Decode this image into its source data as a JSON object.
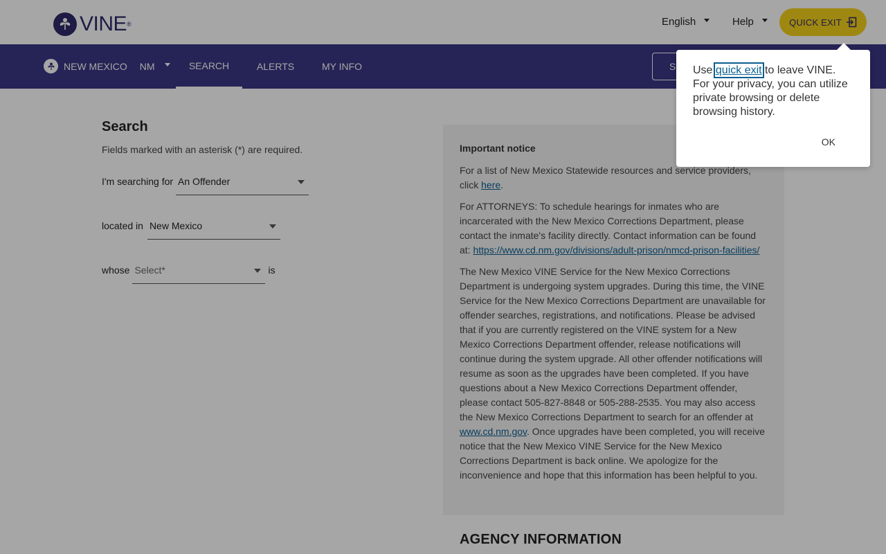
{
  "header": {
    "logo_text": "VINE",
    "logo_reg": "®",
    "language": "English",
    "help": "Help",
    "quick_exit": "QUICK EXIT"
  },
  "nav": {
    "state_name": "NEW MEXICO",
    "state_code": "NM",
    "tabs": [
      {
        "label": "SEARCH",
        "active": true
      },
      {
        "label": "ALERTS",
        "active": false
      },
      {
        "label": "MY INFO",
        "active": false
      }
    ],
    "right_button": "S"
  },
  "search": {
    "title": "Search",
    "hint": "Fields marked with an asterisk (*) are required.",
    "searching_for_label": "I'm searching for",
    "searching_for_value": "An Offender",
    "located_in_label": "located in",
    "located_in_value": "New Mexico",
    "whose_label": "whose",
    "whose_placeholder": "Select*",
    "is_label": "is"
  },
  "notice": {
    "title": "Important notice",
    "p1_text": "For a list of New Mexico Statewide resources and service providers, click ",
    "p1_link": "here",
    "p1_end": ".",
    "p2_text": "For ATTORNEYS: To schedule hearings for inmates who are incarcerated with the New Mexico Corrections Department, please contact the inmate's facility directly. Contact information can be found at: ",
    "p2_link": "https://www.cd.nm.gov/divisions/adult-prison/nmcd-prison-facilities/",
    "p3_text": "The New Mexico VINE Service for the New Mexico Corrections Department is undergoing system upgrades. During this time, the VINE Service for the New Mexico Corrections Department are unavailable for offender searches, registrations, and notifications. Please be advised that if you are currently registered on the VINE system for a New Mexico Corrections Department offender, release notifications will continue during the system upgrade. All other offender notifications will resume as soon as the upgrades have been completed. If you have questions about a New Mexico Corrections Department offender, please contact 505-827-8848 or 505-288-2535. You may also access the New Mexico Corrections Department to search for an offender at ",
    "p3_link": "www.cd.nm.gov",
    "p3_end": ". Once upgrades have been completed, you will receive notice that the New Mexico VINE Service for the New Mexico Corrections Department is back online. We apologize for the inconvenience and hope that this information has been helpful to you."
  },
  "agency_title": "AGENCY INFORMATION",
  "popover": {
    "text_before": "Use ",
    "link": "quick exit",
    "text_after": " to leave VINE. For your privacy, you can utilize private browsing or delete browsing history.",
    "ok": "OK"
  },
  "colors": {
    "brand": "#3b3784",
    "quick_exit": "#f3d21b",
    "link": "#0b5f8f"
  }
}
